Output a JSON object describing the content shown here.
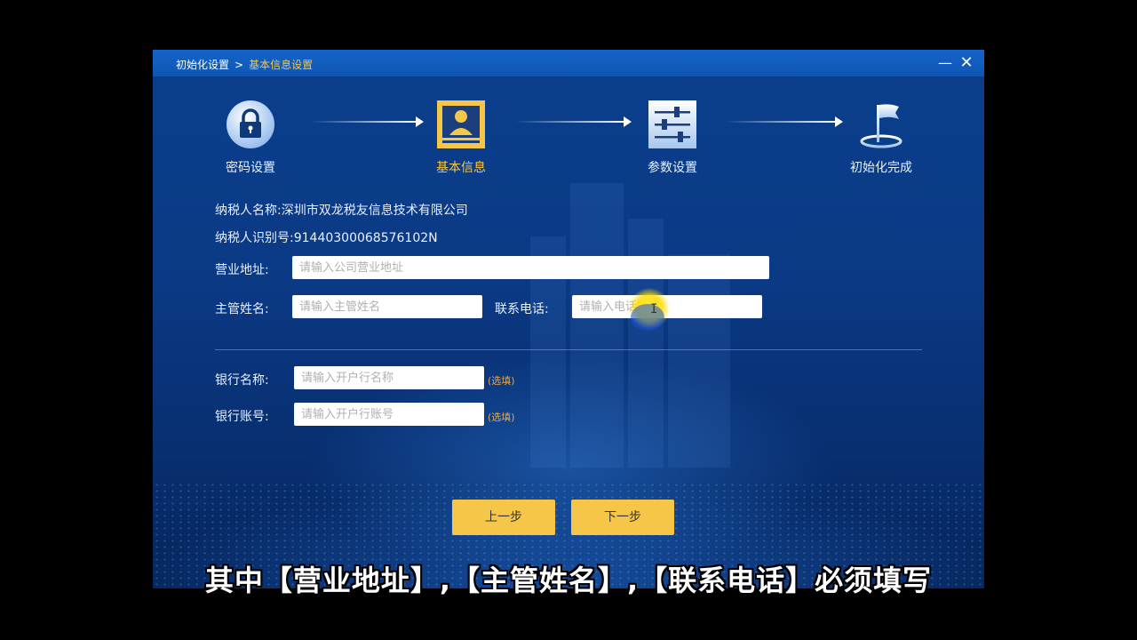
{
  "titlebar": {
    "breadcrumb_root": "初始化设置",
    "breadcrumb_sep": ">",
    "breadcrumb_current": "基本信息设置",
    "minimize_glyph": "—",
    "close_glyph": "✕"
  },
  "steps": [
    {
      "label": "密码设置",
      "icon": "lock-icon",
      "active": false
    },
    {
      "label": "基本信息",
      "icon": "id-card-icon",
      "active": true
    },
    {
      "label": "参数设置",
      "icon": "sliders-icon",
      "active": false
    },
    {
      "label": "初始化完成",
      "icon": "flag-icon",
      "active": false
    }
  ],
  "info": {
    "taxpayer_name": "纳税人名称:深圳市双龙税友信息技术有限公司",
    "taxpayer_id": "纳税人识别号:91440300068576102N"
  },
  "form": {
    "address_label": "营业地址:",
    "address_placeholder": "请输入公司营业地址",
    "manager_label": "主管姓名:",
    "manager_placeholder": "请输入主管姓名",
    "phone_label": "联系电话:",
    "phone_placeholder": "请输入电话号码",
    "bank_name_label": "银行名称:",
    "bank_name_placeholder": "请输入开户行名称",
    "bank_account_label": "银行账号:",
    "bank_account_placeholder": "请输入开户行账号",
    "optional_note": "(选填)"
  },
  "buttons": {
    "prev": "上一步",
    "next": "下一步"
  },
  "colors": {
    "accent": "#f5c648",
    "active_step": "#f5c74a",
    "optional": "#f0a53a",
    "titlebar": "#1464c8"
  },
  "subtitle": "其中【营业地址】,【主管姓名】,【联系电话】必须填写"
}
